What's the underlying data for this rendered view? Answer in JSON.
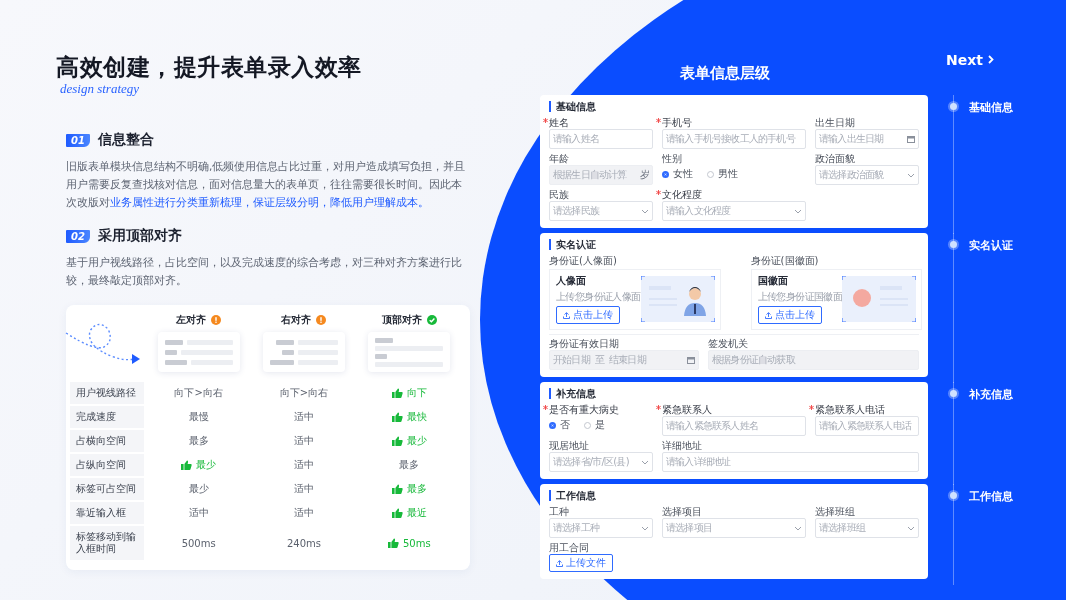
{
  "heading": {
    "title": "高效创建，提升表单录入效率",
    "script": "design strategy"
  },
  "sections": [
    {
      "number": "01",
      "title": "信息整合",
      "body": "旧版表单模块信息结构不明确,低频使用信息占比过重，对用户造成填写负担，并且用户需要反复查找核对信息，面对信息量大的表单页，往往需要很长时间。因此本次改版对",
      "highlight": "业务属性进行分类重新梳理，保证层级分明，降低用户理解成本。"
    },
    {
      "number": "02",
      "title": "采用顶部对齐",
      "body": "基于用户视线路径，占比空间，以及完成速度的综合考虑，对三种对齐方案进行比较，最终敲定顶部对齐。"
    }
  ],
  "comparison": {
    "columns": [
      {
        "title": "左对齐",
        "recommended": false,
        "kind": "left"
      },
      {
        "title": "右对齐",
        "recommended": false,
        "kind": "right"
      },
      {
        "title": "顶部对齐",
        "recommended": true,
        "kind": "top"
      }
    ],
    "rows": [
      {
        "label": "用户视线路径",
        "cells": [
          {
            "text": "向下>向右",
            "best": false
          },
          {
            "text": "向下>向右",
            "best": false
          },
          {
            "text": "向下",
            "best": true
          }
        ]
      },
      {
        "label": "完成速度",
        "cells": [
          {
            "text": "最慢",
            "best": false
          },
          {
            "text": "适中",
            "best": false
          },
          {
            "text": "最快",
            "best": true
          }
        ]
      },
      {
        "label": "占横向空间",
        "cells": [
          {
            "text": "最多",
            "best": false
          },
          {
            "text": "适中",
            "best": false
          },
          {
            "text": "最少",
            "best": true
          }
        ]
      },
      {
        "label": "占纵向空间",
        "cells": [
          {
            "text": "最少",
            "best": true
          },
          {
            "text": "适中",
            "best": false
          },
          {
            "text": "最多",
            "best": false
          }
        ]
      },
      {
        "label": "标签可占空间",
        "cells": [
          {
            "text": "最少",
            "best": false
          },
          {
            "text": "适中",
            "best": false
          },
          {
            "text": "最多",
            "best": true
          }
        ]
      },
      {
        "label": "靠近输入框",
        "cells": [
          {
            "text": "适中",
            "best": false
          },
          {
            "text": "适中",
            "best": false
          },
          {
            "text": "最近",
            "best": true
          }
        ]
      },
      {
        "label": "标签移动到输入框时间",
        "cells": [
          {
            "text": "500ms",
            "best": false
          },
          {
            "text": "240ms",
            "best": false
          },
          {
            "text": "50ms",
            "best": true
          }
        ]
      }
    ]
  },
  "form": {
    "title": "表单信息层级",
    "cards": [
      {
        "title": "基础信息",
        "kind": "fields",
        "fields": [
          {
            "label": "姓名",
            "required": true,
            "kind": "input",
            "placeholder": "请输入姓名"
          },
          {
            "label": "手机号",
            "required": true,
            "kind": "input",
            "placeholder": "请输入手机号接收工人的手机号"
          },
          {
            "label": "出生日期",
            "required": false,
            "kind": "date",
            "placeholder": "请输入出生日期"
          },
          {
            "label": "年龄",
            "required": false,
            "kind": "readonly",
            "placeholder": "根据生日自动计算",
            "suffix": "岁"
          },
          {
            "label": "性别",
            "required": false,
            "kind": "radio",
            "options": [
              {
                "label": "女性",
                "selected": true
              },
              {
                "label": "男性",
                "selected": false
              }
            ]
          },
          {
            "label": "政治面貌",
            "required": false,
            "kind": "select",
            "placeholder": "请选择政治面貌"
          },
          {
            "label": "民族",
            "required": false,
            "kind": "select",
            "placeholder": "请选择民族"
          },
          {
            "label": "文化程度",
            "required": true,
            "kind": "select",
            "placeholder": "请输入文化程度"
          }
        ]
      },
      {
        "title": "实名认证",
        "kind": "identity",
        "uploads": [
          {
            "label": "身份证(人像面)",
            "title": "人像面",
            "hint": "上传您身份证人像面",
            "button": "点击上传",
            "kind": "portrait"
          },
          {
            "label": "身份证(国徽面)",
            "title": "国徽面",
            "hint": "上传您身份证国徽面",
            "button": "点击上传",
            "kind": "emblem"
          }
        ],
        "fields": [
          {
            "label": "身份证有效日期",
            "required": false,
            "kind": "daterange",
            "start": "开始日期",
            "separator": "至",
            "end": "结束日期"
          },
          {
            "label": "签发机关",
            "required": false,
            "kind": "readonly",
            "placeholder": "根据身份证自动获取",
            "wide": true
          }
        ]
      },
      {
        "title": "补充信息",
        "kind": "fields",
        "fields": [
          {
            "label": "是否有重大病史",
            "required": true,
            "kind": "radio",
            "options": [
              {
                "label": "否",
                "selected": true
              },
              {
                "label": "是",
                "selected": false
              }
            ]
          },
          {
            "label": "紧急联系人",
            "required": true,
            "kind": "input",
            "placeholder": "请输入紧急联系人姓名"
          },
          {
            "label": "紧急联系人电话",
            "required": true,
            "kind": "input",
            "placeholder": "请输入紧急联系人电话"
          },
          {
            "label": "现居地址",
            "required": false,
            "kind": "select",
            "placeholder": "请选择省/市/区(县)"
          },
          {
            "label": "详细地址",
            "required": false,
            "kind": "input",
            "placeholder": "请输入详细地址",
            "wide": true
          }
        ]
      },
      {
        "title": "工作信息",
        "kind": "fields",
        "fields": [
          {
            "label": "工种",
            "required": false,
            "kind": "select",
            "placeholder": "请选择工种"
          },
          {
            "label": "选择项目",
            "required": false,
            "kind": "select",
            "placeholder": "请选择项目"
          },
          {
            "label": "选择班组",
            "required": false,
            "kind": "select",
            "placeholder": "请选择班组"
          },
          {
            "label": "用工合同",
            "required": false,
            "kind": "upload",
            "button": "上传文件"
          }
        ]
      }
    ]
  },
  "steps": [
    {
      "label": "基础信息"
    },
    {
      "label": "实名认证"
    },
    {
      "label": "补充信息"
    },
    {
      "label": "工作信息"
    }
  ],
  "next": {
    "label": "Next"
  }
}
